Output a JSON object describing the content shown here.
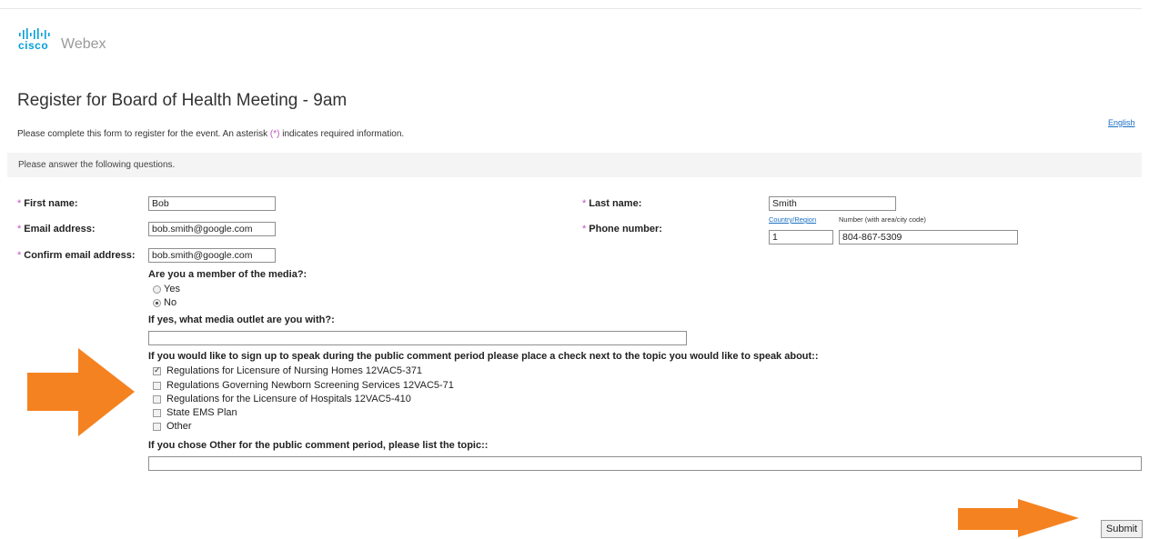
{
  "brand": {
    "cisco": "cisco",
    "product": "Webex",
    "color": "#049fd9"
  },
  "page": {
    "title": "Register for Board of Health Meeting - 9am",
    "language_link": "English",
    "intro_before": "Please complete this form to register for the event. An asterisk ",
    "intro_asterisk": "(*)",
    "intro_after": " indicates required information.",
    "questions_header": "Please answer the following questions."
  },
  "form": {
    "first_name": {
      "label": "First name:",
      "value": "Bob"
    },
    "last_name": {
      "label": "Last name:",
      "value": "Smith"
    },
    "email": {
      "label": "Email address:",
      "value": "bob.smith@google.com"
    },
    "confirm_email": {
      "label": "Confirm email address:",
      "value": "bob.smith@google.com"
    },
    "phone": {
      "label": "Phone number:",
      "country_link": "Country/Region",
      "number_note": "Number (with area/city code)",
      "country_value": "1",
      "number_value": "804-867-5309"
    },
    "media_question": "Are you a member of the media?:",
    "media_options": [
      {
        "label": "Yes",
        "selected": false
      },
      {
        "label": "No",
        "selected": true
      }
    ],
    "outlet_question": "If yes, what media outlet are you with?:",
    "outlet_value": "",
    "speak_question": "If you would like to sign up to speak during the public comment period please place a check next to the topic you would like to speak about::",
    "topics": [
      {
        "label": "Regulations for Licensure of Nursing Homes 12VAC5-371",
        "checked": true
      },
      {
        "label": "Regulations Governing Newborn Screening Services 12VAC5-71",
        "checked": false
      },
      {
        "label": "Regulations for the Licensure of Hospitals 12VAC5-410",
        "checked": false
      },
      {
        "label": "State EMS Plan",
        "checked": false
      },
      {
        "label": "Other",
        "checked": false
      }
    ],
    "other_question": "If you chose Other for the public comment period, please list the topic::",
    "other_value": "",
    "submit_label": "Submit"
  },
  "annotations": {
    "arrow_color": "#f58220"
  }
}
